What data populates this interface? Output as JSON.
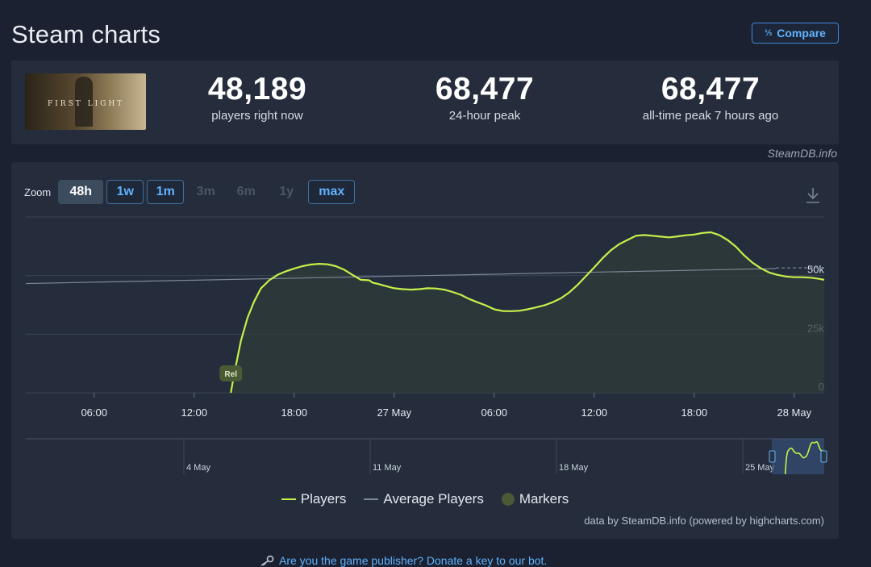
{
  "page": {
    "title": "Steam charts",
    "compare_label": "Compare",
    "compare_icon": "1/2/3"
  },
  "stats": {
    "thumb_text": "FIRST LIGHT",
    "now_value": "48,189",
    "now_label": "players right now",
    "peak24_value": "68,477",
    "peak24_label": "24-hour peak",
    "alltime_value": "68,477",
    "alltime_label": "all-time peak 7 hours ago",
    "credit": "SteamDB.info"
  },
  "zoom": {
    "label": "Zoom",
    "buttons": [
      {
        "label": "48h",
        "state": "active"
      },
      {
        "label": "1w",
        "state": "link"
      },
      {
        "label": "1m",
        "state": "link"
      },
      {
        "label": "3m",
        "state": "disabled"
      },
      {
        "label": "6m",
        "state": "disabled"
      },
      {
        "label": "1y",
        "state": "disabled"
      },
      {
        "label": "max",
        "state": "link"
      }
    ]
  },
  "chart_data": {
    "type": "line",
    "x_ticks": [
      "06:00",
      "12:00",
      "18:00",
      "27 May",
      "06:00",
      "12:00",
      "18:00",
      "28 May"
    ],
    "x_tick_hours": [
      6,
      12,
      18,
      24,
      30,
      36,
      42,
      48
    ],
    "x_range_hours": [
      1.9,
      49.8
    ],
    "y_ticks": [
      "0",
      "25k",
      "50k"
    ],
    "ylim": [
      0,
      75000
    ],
    "marker_label": "Rel",
    "marker_hour": 14.2,
    "series": [
      {
        "name": "Players",
        "color": "#c5f04a",
        "x": [
          14.2,
          14.4,
          14.8,
          15.2,
          15.6,
          16.0,
          16.5,
          17.0,
          17.5,
          18.0,
          18.5,
          19.0,
          19.5,
          20.0,
          20.5,
          21.0,
          21.5,
          22.0,
          22.5,
          22.7,
          23.0,
          23.5,
          24.0,
          24.5,
          25.0,
          25.5,
          26.0,
          26.5,
          27.0,
          27.5,
          28.0,
          28.5,
          29.0,
          29.5,
          30.0,
          30.5,
          31.0,
          31.5,
          32.0,
          32.5,
          33.0,
          33.5,
          34.0,
          34.5,
          35.0,
          35.5,
          36.0,
          36.5,
          37.0,
          37.5,
          38.0,
          38.5,
          39.0,
          39.5,
          40.0,
          40.5,
          41.0,
          41.5,
          42.0,
          42.5,
          43.0,
          43.5,
          44.0,
          44.5,
          45.0,
          45.5,
          46.0,
          46.5,
          47.0,
          47.5,
          48.0,
          48.5,
          49.0,
          49.5,
          49.8
        ],
        "y": [
          0,
          8000,
          22000,
          32000,
          39000,
          44500,
          48000,
          50300,
          51800,
          53000,
          54000,
          54700,
          55000,
          54800,
          54000,
          52500,
          50300,
          48200,
          48000,
          47000,
          46500,
          45500,
          44600,
          44200,
          44000,
          44200,
          44600,
          44500,
          44000,
          43000,
          41800,
          40000,
          38600,
          37300,
          35600,
          34900,
          34800,
          35000,
          35600,
          36400,
          37300,
          38600,
          40300,
          42800,
          46000,
          49700,
          53500,
          57400,
          60800,
          63400,
          65200,
          67000,
          67300,
          67000,
          66600,
          66300,
          66700,
          67200,
          67500,
          68200,
          68477,
          67300,
          65200,
          62300,
          58600,
          55500,
          53100,
          51300,
          50300,
          49600,
          49300,
          49300,
          49100,
          48600,
          48189
        ]
      },
      {
        "name": "Average Players",
        "color": "#7d8797",
        "x": [
          1.9,
          49.8
        ],
        "y": [
          46600,
          53400
        ]
      }
    ],
    "legend": [
      "Players",
      "Average Players",
      "Markers"
    ],
    "navigator_ticks": [
      "4 May",
      "11 May",
      "18 May",
      "25 May"
    ]
  },
  "footer": {
    "data_credit": "data by SteamDB.info (powered by highcharts.com)",
    "publisher_link": "Are you the game publisher? Donate a key to our bot."
  }
}
